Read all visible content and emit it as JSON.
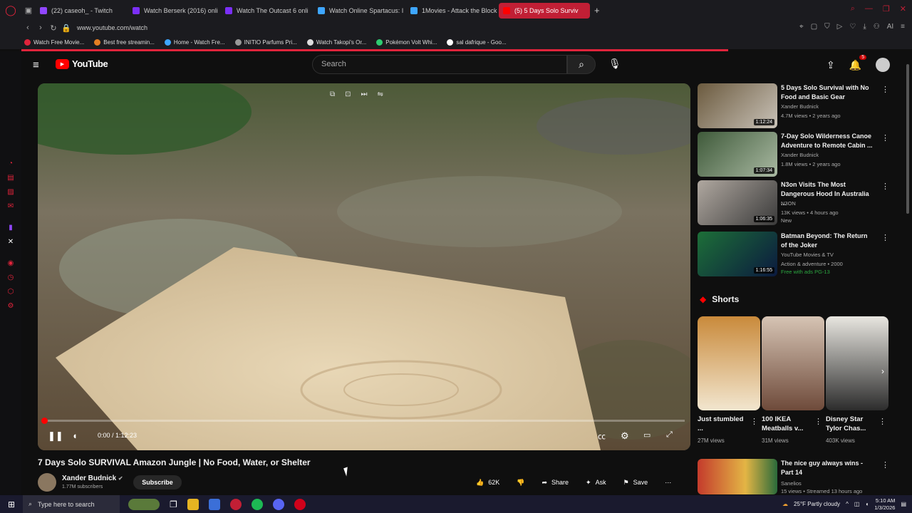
{
  "browser": {
    "tabs": [
      {
        "label": "(22) caseoh_ - Twitch",
        "color": "#9146ff"
      },
      {
        "label": "Watch Berserk (2016) onli",
        "color": "#7b2ff7"
      },
      {
        "label": "Watch The Outcast 6 onli",
        "color": "#7b2ff7"
      },
      {
        "label": "Watch Online Spartacus: I",
        "color": "#3ea6ff"
      },
      {
        "label": "1Movies - Attack the Block",
        "color": "#3ea6ff"
      },
      {
        "label": "(5) 5 Days Solo Surviv",
        "color": "#ff0000",
        "active": true
      }
    ],
    "url": "www.youtube.com/watch",
    "bookmarks": [
      {
        "label": "Watch Free Movie...",
        "color": "#e0243b"
      },
      {
        "label": "Best free streamin...",
        "color": "#e67e22"
      },
      {
        "label": "Home - Watch Fre...",
        "color": "#3ea6ff"
      },
      {
        "label": "INITIO Parfums Pri...",
        "color": "#999999"
      },
      {
        "label": "Watch Takopi's Or...",
        "color": "#dddddd"
      },
      {
        "label": "Pokémon Volt Whi...",
        "color": "#2ecc71"
      },
      {
        "label": "sal dafrique - Goo...",
        "color": "#ffffff"
      }
    ]
  },
  "youtube": {
    "logo_text": "YouTube",
    "search_placeholder": "Search",
    "notification_count": "5"
  },
  "player": {
    "time": "0:00 / 1:12:23",
    "progress": 0.0
  },
  "video": {
    "title": "7 Days Solo SURVIVAL Amazon Jungle | No Food, Water, or Shelter",
    "channel": "Xander Budnick",
    "subscribers": "1.77M subscribers",
    "subscribe_label": "Subscribe",
    "likes": "62K",
    "share_label": "Share",
    "ask_label": "Ask",
    "save_label": "Save"
  },
  "recommendations": [
    {
      "title": "5 Days Solo Survival with No Food and Basic Gear",
      "channel": "Xander Budnick",
      "meta": "4.7M views • 2 years ago",
      "duration": "1:12:24",
      "colors": [
        "#6b5a3e",
        "#c9c2b8"
      ]
    },
    {
      "title": "7-Day Solo Wilderness Canoe Adventure to Remote Cabin ...",
      "channel": "Xander Budnick",
      "meta": "1.8M views • 2 years ago",
      "duration": "1:07:34",
      "colors": [
        "#3f5a3a",
        "#a9b9a2"
      ]
    },
    {
      "title": "N3on Visits The Most Dangerous Hood In Australia ...",
      "channel": "N3ON",
      "meta": "13K views • 4 hours ago",
      "extra": "New",
      "duration": "1:06:35",
      "colors": [
        "#b0a8a0",
        "#3a3a3a"
      ]
    },
    {
      "title": "Batman Beyond: The Return of the Joker",
      "channel": "YouTube Movies & TV",
      "meta": "Action & adventure • 2000",
      "extra": "Free with ads  PG-13",
      "duration": "1:16:55",
      "colors": [
        "#1d6f38",
        "#0b1a3f"
      ]
    }
  ],
  "shorts": {
    "heading": "Shorts",
    "items": [
      {
        "title": "Just stumbled ...",
        "views": "27M views",
        "colors": [
          "#c98a3b",
          "#f2e6cf"
        ]
      },
      {
        "title": "100 IKEA Meatballs v...",
        "views": "31M views",
        "colors": [
          "#d6c4b4",
          "#6e4a3a"
        ]
      },
      {
        "title": "Disney Star Tylor Chas...",
        "views": "403K views",
        "colors": [
          "#e8e6e0",
          "#2c2c2c"
        ]
      }
    ]
  },
  "next_rec": {
    "title": "The nice guy always wins - Part 14",
    "channel": "Sanelios",
    "meta": "15 views • Streamed 13 hours ago"
  },
  "taskbar": {
    "search_placeholder": "Type here to search",
    "weather": "25°F  Partly cloudy",
    "time": "5:10 AM",
    "date": "1/3/2026"
  }
}
